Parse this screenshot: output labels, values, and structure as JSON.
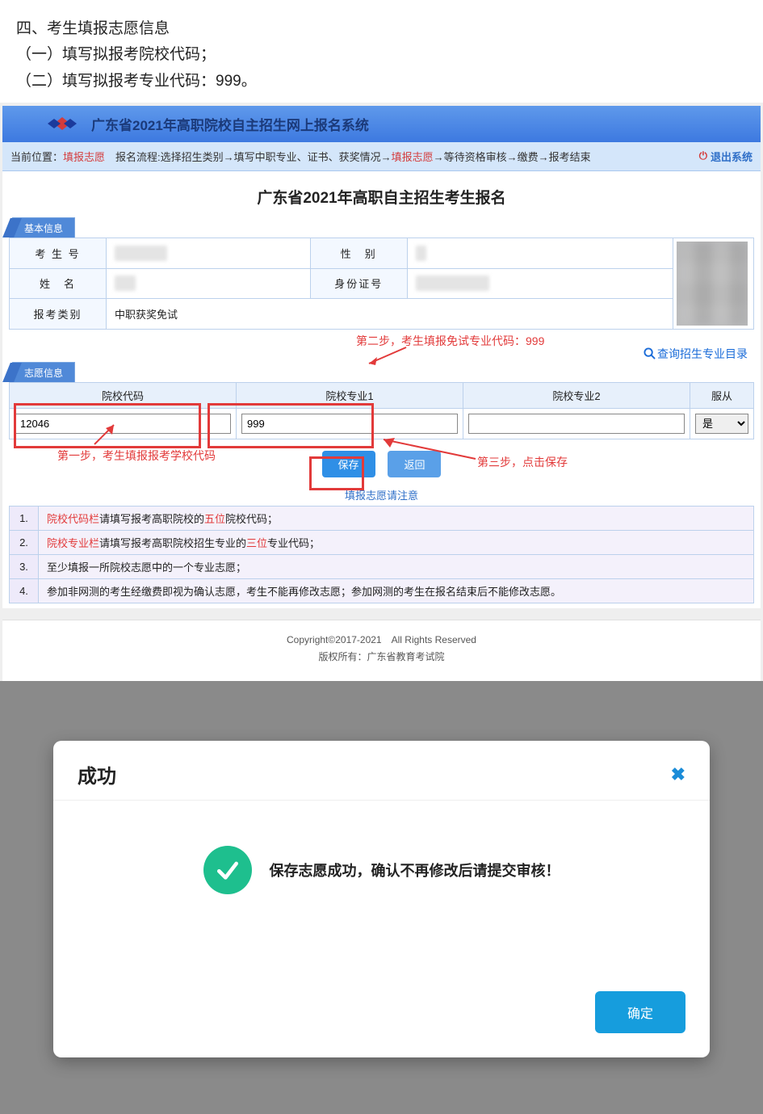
{
  "doc": {
    "section_title": "四、考生填报志愿信息",
    "line1": "（一）填写拟报考院校代码；",
    "line2": "（二）填写拟报考专业代码：999。"
  },
  "header": {
    "title": "广东省2021年高职院校自主招生网上报名系统"
  },
  "breadcrumb": {
    "prefix": "当前位置：",
    "current": "填报志愿",
    "trail_a": "　报名流程:选择招生类别→填写中职专业、证书、获奖情况→",
    "trail_hl": "填报志愿",
    "trail_b": "→等待资格审核→缴费→报考结束",
    "logout": "退出系统"
  },
  "inner_title": "广东省2021年高职自主招生考生报名",
  "basic": {
    "tab": "基本信息",
    "labels": {
      "sno": "考 生 号",
      "gender": "性　别",
      "name": "姓　名",
      "idno": "身份证号",
      "cat": "报考类别"
    },
    "values": {
      "sno": "　　　　　",
      "gender": "　",
      "name": "　　",
      "idno": "　　　　　　　",
      "cat": "中职获奖免试"
    }
  },
  "anno": {
    "step1": "第一步，考生填报报考学校代码",
    "step2": "第二步，考生填报免试专业代码：999",
    "step3": "第三步，点击保存"
  },
  "vol": {
    "tab": "志愿信息",
    "search": "查询招生专业目录",
    "headers": {
      "code": "院校代码",
      "major1": "院校专业1",
      "major2": "院校专业2",
      "obey": "服从"
    },
    "values": {
      "code": "12046",
      "major1": "999",
      "major2": "",
      "obey": "是"
    }
  },
  "buttons": {
    "save": "保存",
    "back": "返回"
  },
  "notes": {
    "head": "填报志愿请注意",
    "rows": [
      {
        "n": "1.",
        "a": "院校代码栏",
        "b": "请填写报考高职院校的",
        "c": "五位",
        "d": "院校代码；"
      },
      {
        "n": "2.",
        "a": "院校专业栏",
        "b": "请填写报考高职院校招生专业的",
        "c": "三位",
        "d": "专业代码；"
      },
      {
        "n": "3.",
        "a": "",
        "b": "至少填报一所院校志愿中的一个专业志愿；",
        "c": "",
        "d": ""
      },
      {
        "n": "4.",
        "a": "",
        "b": "参加非网测的考生经缴费即视为确认志愿，考生不能再修改志愿；参加网测的考生在报名结束后不能修改志愿。",
        "c": "",
        "d": ""
      }
    ]
  },
  "footer": {
    "copy": "Copyright©2017-2021　All Rights Reserved",
    "owner": "版权所有：广东省教育考试院"
  },
  "modal": {
    "title": "成功",
    "message": "保存志愿成功，确认不再修改后请提交审核！",
    "ok": "确定"
  }
}
